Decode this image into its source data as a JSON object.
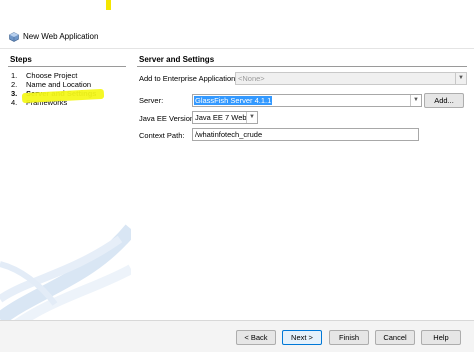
{
  "window": {
    "title": "New Web Application"
  },
  "steps": {
    "header": "Steps",
    "items": [
      {
        "num": "1.",
        "label": "Choose Project"
      },
      {
        "num": "2.",
        "label": "Name and Location"
      },
      {
        "num": "3.",
        "label": "Server and Settings"
      },
      {
        "num": "4.",
        "label": "Frameworks"
      }
    ],
    "active_index": 2
  },
  "settings": {
    "header": "Server and Settings",
    "enterprise_label": "Add to Enterprise Application:",
    "enterprise_value": "<None>",
    "server_label": "Server:",
    "server_value": "GlassFish Server 4.1.1",
    "add_button": "Add...",
    "javaee_label": "Java EE Version:",
    "javaee_value": "Java EE 7 Web",
    "context_label": "Context Path:",
    "context_value": "/whatinfotech_crude"
  },
  "footer": {
    "back": "< Back",
    "next": "Next >",
    "finish": "Finish",
    "cancel": "Cancel",
    "help": "Help"
  },
  "colors": {
    "highlight": "#f4f81a",
    "selection": "#3399ff"
  }
}
